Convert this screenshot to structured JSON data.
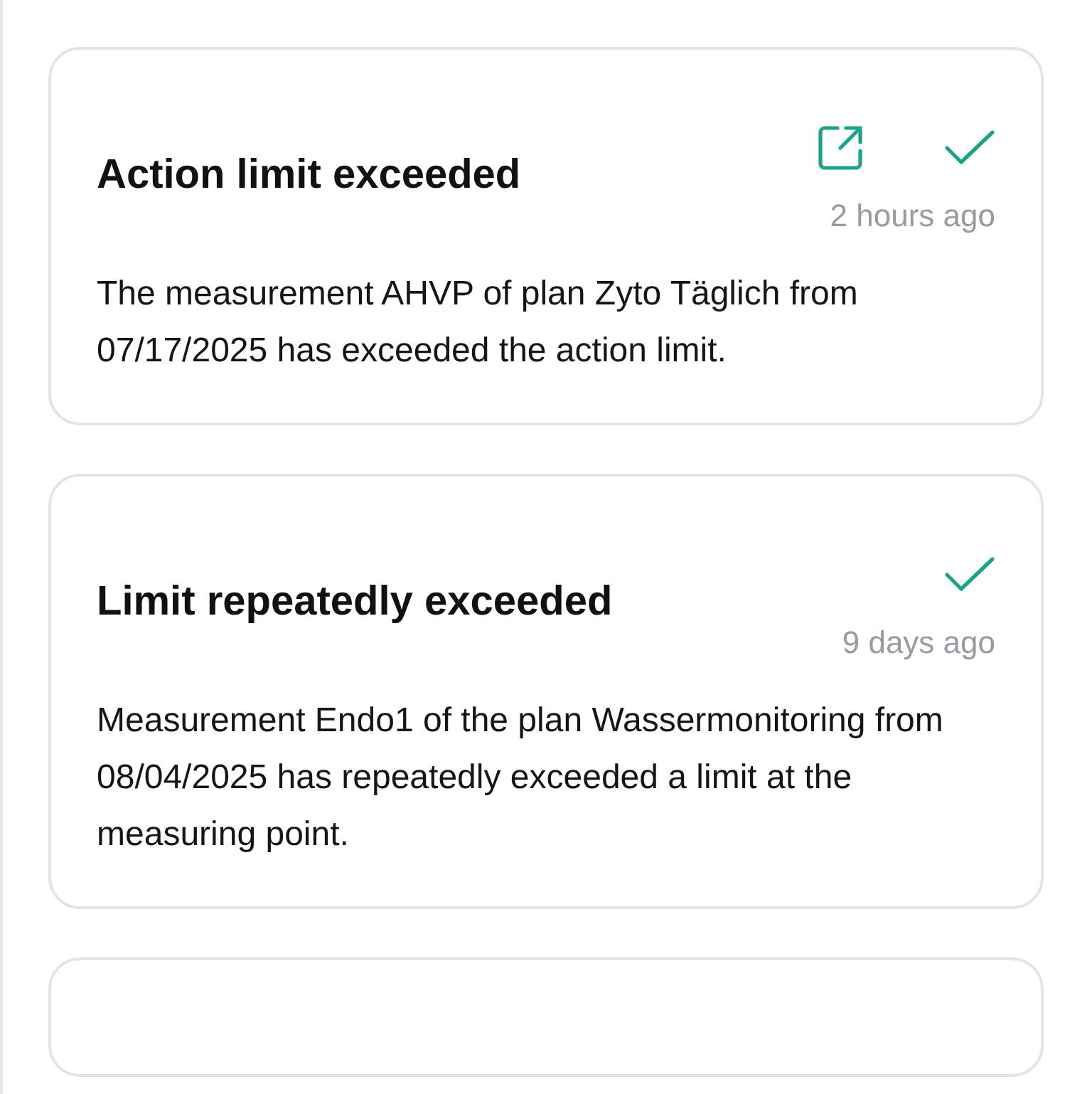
{
  "notifications": [
    {
      "title": "Action limit exceeded",
      "time": "2 hours ago",
      "message": "The measurement AHVP of plan Zyto Täglich from 07/17/2025 has exceeded the action limit.",
      "has_link": true
    },
    {
      "title": "Limit repeatedly exceeded",
      "time": "9 days ago",
      "message": "Measurement Endo1 of the plan Wassermonitoring from 08/04/2025 has repeatedly exceeded a limit at the measuring point.",
      "has_link": false
    }
  ]
}
